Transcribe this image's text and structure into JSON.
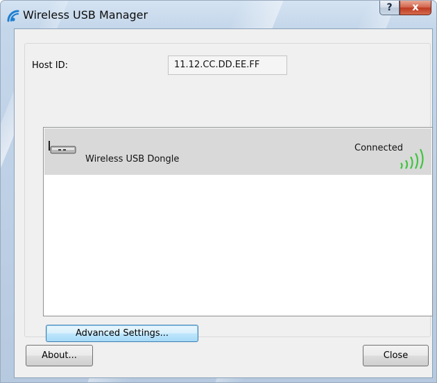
{
  "window": {
    "title": "Wireless USB Manager",
    "help_glyph": "?",
    "close_glyph": "x"
  },
  "host": {
    "label": "Host ID:",
    "value": "11.12.CC.DD.EE.FF"
  },
  "devices": [
    {
      "name": "Wireless USB Dongle",
      "status": "Connected",
      "icon": "usb-dongle-icon",
      "signal_bars": 5,
      "signal_bars_total": 5
    }
  ],
  "buttons": {
    "advanced": "Advanced Settings...",
    "about": "About...",
    "close": "Close"
  },
  "colors": {
    "selected_row": "#d9d9d9",
    "signal": "#3fc43f",
    "app_icon": "#1f7fd0"
  }
}
